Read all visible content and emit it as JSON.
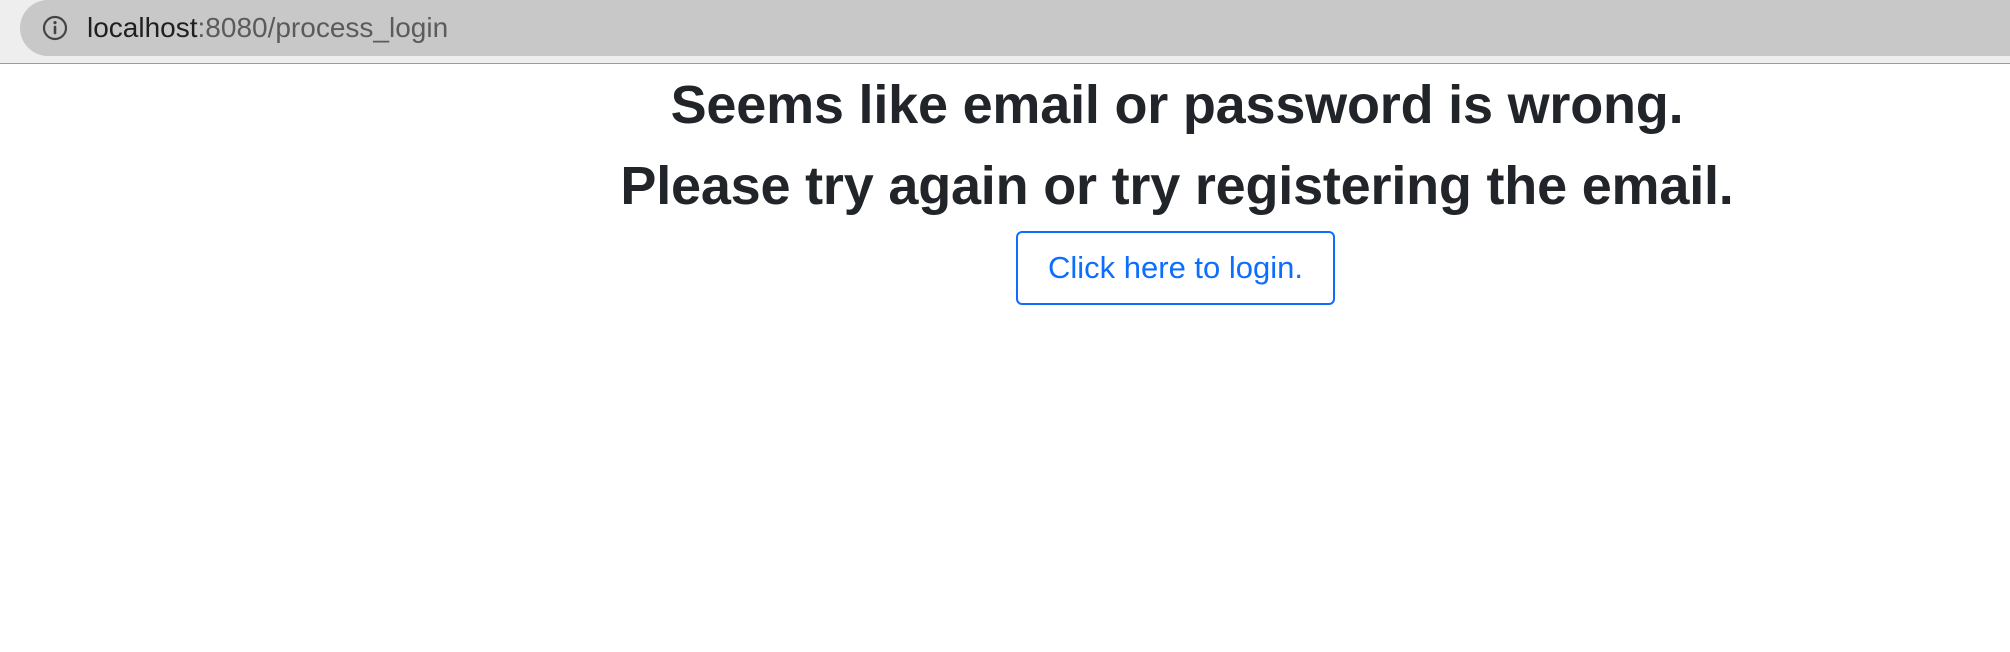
{
  "browser": {
    "url_host": "localhost",
    "url_rest": ":8080/process_login",
    "info_icon": "info-icon"
  },
  "main": {
    "message_line_1": "Seems like email or password is wrong.",
    "message_line_2": "Please try again or try registering the email.",
    "login_button_label": "Click here to login."
  },
  "colors": {
    "primary": "#0d6efd",
    "text": "#212529",
    "address_bar": "#c8c8c8"
  }
}
